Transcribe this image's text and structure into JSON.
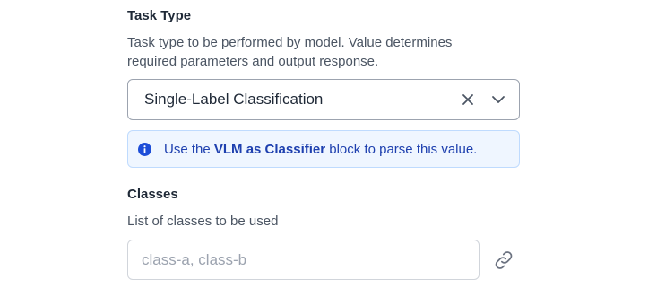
{
  "task_type": {
    "label": "Task Type",
    "description_line1": "Task type to be performed by model. Value determines",
    "description_line2": "required parameters and output response.",
    "selected_value": "Single-Label Classification",
    "info": {
      "prefix": "Use the ",
      "highlight": "VLM as Classifier",
      "suffix": " block to parse this value."
    }
  },
  "classes": {
    "label": "Classes",
    "description": "List of classes to be used",
    "placeholder": "class-a, class-b",
    "value": ""
  },
  "icons": {
    "clear": "close-icon",
    "dropdown": "chevron-down-icon",
    "info": "info-icon",
    "link": "link-icon"
  },
  "colors": {
    "info_bg": "#eff6ff",
    "info_border": "#bfdbfe",
    "info_text": "#1e40af",
    "info_icon": "#1d4ed8"
  }
}
